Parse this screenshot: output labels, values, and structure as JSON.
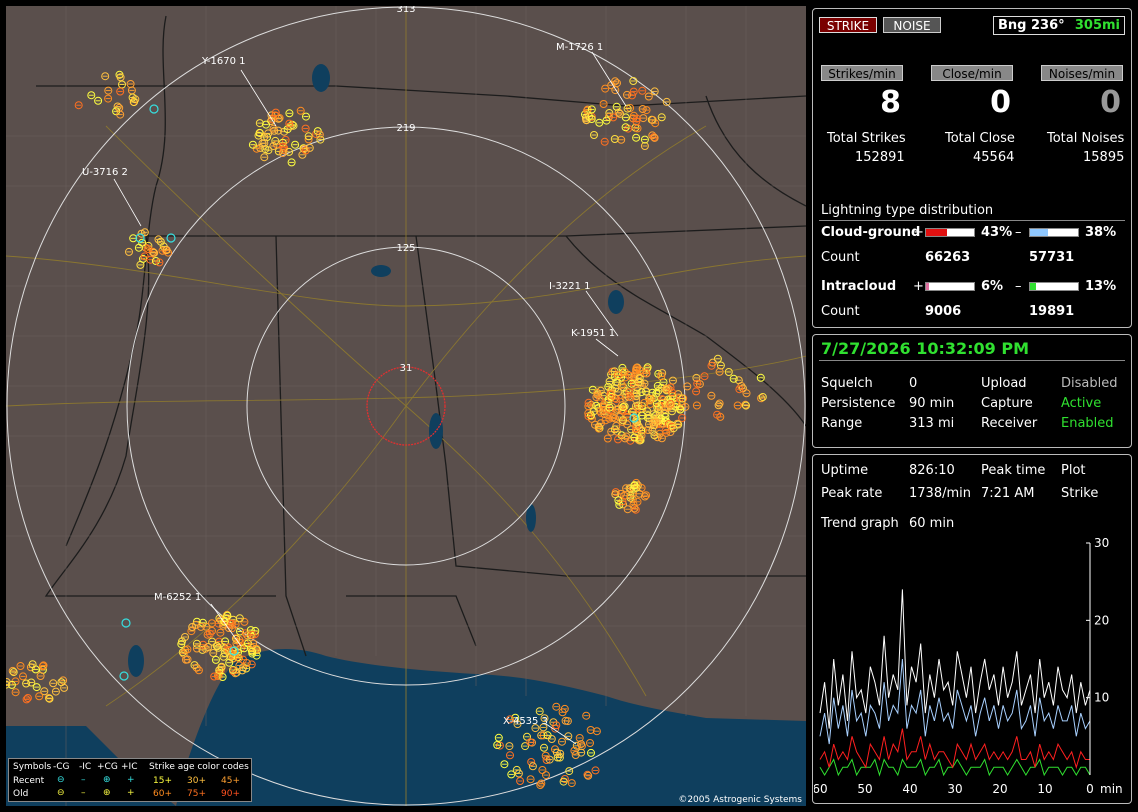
{
  "map": {
    "copyright": "©2005 Astrogenic Systems",
    "ring_labels": [
      "31",
      "125",
      "219",
      "313"
    ],
    "storm_labels": [
      "Y-1670 1",
      "M-1726 1",
      "U-3716 2",
      "I-3221 1",
      "K-1951 1",
      "M-6252 1",
      "X-4535 3"
    ],
    "legend": {
      "symbols_label": "Symbols",
      "columns": [
        "-CG",
        "-IC",
        "+CG",
        "+IC"
      ],
      "recent_label": "Recent",
      "old_label": "Old",
      "age_title": "Strike age color codes",
      "age_recent": [
        "15+",
        "30+",
        "45+"
      ],
      "age_old": [
        "60+",
        "75+",
        "90+"
      ]
    }
  },
  "status": {
    "strike_button": "STRIKE",
    "noise_button": "NOISE",
    "bearing": "Bng 236°",
    "distance": "305mi",
    "strikes_min_label": "Strikes/min",
    "close_min_label": "Close/min",
    "noises_min_label": "Noises/min",
    "strikes_min": "8",
    "close_min": "0",
    "noises_min": "0",
    "total_strikes_label": "Total Strikes",
    "total_close_label": "Total Close",
    "total_noises_label": "Total Noises",
    "total_strikes": "152891",
    "total_close": "45564",
    "total_noises": "15895",
    "dist_title": "Lightning type distribution",
    "cg_label": "Cloud-ground",
    "ic_label": "Intracloud",
    "count_label": "Count",
    "plus": "+",
    "minus": "–",
    "cg_pos_pct": "43%",
    "cg_neg_pct": "38%",
    "ic_pos_pct": "6%",
    "ic_neg_pct": "13%",
    "cg_pos_count": "66263",
    "cg_neg_count": "57731",
    "ic_pos_count": "9006",
    "ic_neg_count": "19891",
    "cg_pos_frac": 0.43,
    "cg_neg_frac": 0.38,
    "ic_pos_frac": 0.06,
    "ic_neg_frac": 0.13
  },
  "settings": {
    "datetime": "7/27/2026 10:32:09 PM",
    "squelch_label": "Squelch",
    "squelch": "0",
    "persistence_label": "Persistence",
    "persistence": "90 min",
    "range_label": "Range",
    "range": "313 mi",
    "upload_label": "Upload",
    "upload": "Disabled",
    "capture_label": "Capture",
    "capture": "Active",
    "receiver_label": "Receiver",
    "receiver": "Enabled"
  },
  "stats": {
    "uptime_label": "Uptime",
    "uptime": "826:10",
    "peak_time_label": "Peak time",
    "peak_time": "7:21 AM",
    "plot_label": "Plot",
    "plot": "Strike",
    "peak_rate_label": "Peak rate",
    "peak_rate": "1738/min",
    "trend_label": "Trend graph",
    "trend": "60 min"
  },
  "chart_data": {
    "type": "line",
    "x_ticks": [
      "60",
      "50",
      "40",
      "30",
      "20",
      "10",
      "0"
    ],
    "x_unit": "min",
    "y_ticks": [
      "30",
      "20",
      "10"
    ],
    "ylim": [
      0,
      30
    ],
    "xlim": [
      60,
      0
    ],
    "colors": {
      "total": "#ffffff",
      "cg_neg": "#a8d0ff",
      "cg_pos": "#ff2020",
      "ic": "#30e030"
    },
    "series": [
      {
        "key": "total",
        "values": [
          8,
          12,
          6,
          15,
          9,
          13,
          7,
          16,
          10,
          11,
          8,
          14,
          12,
          9,
          18,
          10,
          13,
          11,
          24,
          9,
          14,
          12,
          17,
          8,
          13,
          10,
          15,
          11,
          12,
          9,
          16,
          13,
          10,
          14,
          8,
          12,
          15,
          11,
          13,
          9,
          14,
          10,
          12,
          16,
          9,
          11,
          13,
          8,
          15,
          10,
          12,
          9,
          14,
          11,
          10,
          13,
          8,
          12,
          9,
          11
        ]
      },
      {
        "key": "cg_neg",
        "values": [
          5,
          8,
          4,
          10,
          6,
          9,
          5,
          11,
          7,
          8,
          5,
          9,
          8,
          6,
          12,
          7,
          9,
          8,
          15,
          6,
          9,
          8,
          11,
          5,
          9,
          7,
          10,
          7,
          8,
          6,
          11,
          9,
          7,
          9,
          5,
          8,
          10,
          7,
          9,
          6,
          9,
          7,
          8,
          11,
          6,
          7,
          9,
          5,
          10,
          7,
          8,
          6,
          9,
          7,
          7,
          9,
          5,
          8,
          6,
          7
        ]
      },
      {
        "key": "cg_pos",
        "values": [
          2,
          3,
          1,
          4,
          2,
          3,
          2,
          5,
          3,
          2,
          1,
          4,
          3,
          2,
          5,
          2,
          4,
          3,
          6,
          2,
          3,
          3,
          5,
          2,
          4,
          2,
          3,
          3,
          2,
          1,
          4,
          3,
          2,
          4,
          2,
          3,
          4,
          2,
          3,
          2,
          3,
          2,
          3,
          5,
          2,
          2,
          3,
          1,
          4,
          2,
          3,
          2,
          4,
          3,
          2,
          3,
          1,
          3,
          2,
          2
        ]
      },
      {
        "key": "ic",
        "values": [
          1,
          0,
          1,
          2,
          0,
          1,
          1,
          2,
          0,
          1,
          1,
          1,
          2,
          0,
          2,
          1,
          1,
          0,
          2,
          1,
          1,
          1,
          2,
          0,
          1,
          1,
          2,
          0,
          1,
          1,
          2,
          1,
          0,
          1,
          1,
          1,
          2,
          0,
          1,
          1,
          1,
          0,
          1,
          2,
          1,
          0,
          1,
          1,
          2,
          0,
          1,
          1,
          1,
          0,
          1,
          1,
          0,
          1,
          1,
          0
        ]
      }
    ]
  }
}
